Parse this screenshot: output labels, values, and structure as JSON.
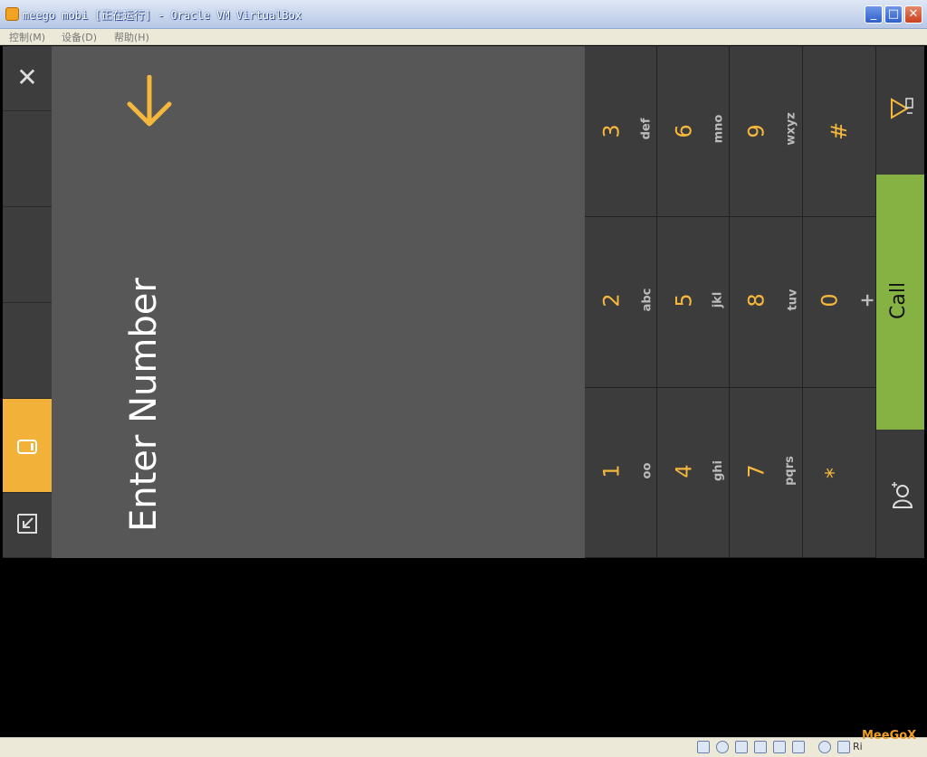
{
  "window": {
    "title": "meego mobi [正在运行] - Oracle VM VirtualBox",
    "minimize_label": "_",
    "maximize_label": "□",
    "close_label": "✕"
  },
  "menubar": {
    "items": [
      "控制(M)",
      "设备(D)",
      "帮助(H)"
    ]
  },
  "leftbar": {
    "close_glyph": "✕",
    "active_item": "phone"
  },
  "display": {
    "placeholder": "Enter Number"
  },
  "keypad": {
    "keys": [
      {
        "digit": "1",
        "letters": "oo"
      },
      {
        "digit": "2",
        "letters": "abc"
      },
      {
        "digit": "3",
        "letters": "def"
      },
      {
        "digit": "4",
        "letters": "ghi"
      },
      {
        "digit": "5",
        "letters": "jkl"
      },
      {
        "digit": "6",
        "letters": "mno"
      },
      {
        "digit": "7",
        "letters": "pqrs"
      },
      {
        "digit": "8",
        "letters": "tuv"
      },
      {
        "digit": "9",
        "letters": "wxyz"
      },
      {
        "digit": "*",
        "letters": ""
      },
      {
        "digit": "0",
        "letters": "+"
      },
      {
        "digit": "#",
        "letters": ""
      }
    ]
  },
  "rightbar": {
    "call_label": "Call"
  },
  "statusbar": {
    "host_key": "Ri"
  },
  "watermark": "MeeGoX",
  "colors": {
    "accent": "#f5b83d",
    "call_green": "#85b243",
    "display_gray": "#575757"
  }
}
